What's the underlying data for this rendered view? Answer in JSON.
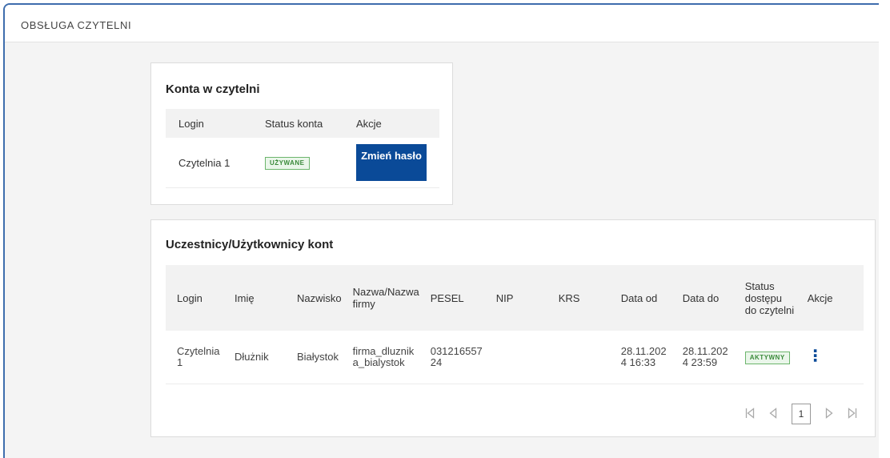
{
  "header": {
    "title": "OBSŁUGA CZYTELNI"
  },
  "accounts": {
    "title": "Konta w czytelni",
    "columns": [
      "Login",
      "Status konta",
      "Akcje"
    ],
    "rows": [
      {
        "login": "Czytelnia 1",
        "status": "UŻYWANE",
        "action": "Zmień hasło"
      }
    ]
  },
  "users": {
    "title": "Uczestnicy/Użytkownicy kont",
    "columns": [
      "Login",
      "Imię",
      "Nazwisko",
      "Nazwa/Nazwa firmy",
      "PESEL",
      "NIP",
      "KRS",
      "Data od",
      "Data do",
      "Status dostępu do czytelni",
      "Akcje"
    ],
    "rows": [
      {
        "login": "Czytelnia 1",
        "first_name": "Dłużnik",
        "last_name": "Białystok",
        "company": "firma_dluznika_bialystok",
        "pesel": "03121655724",
        "nip": "",
        "krs": "",
        "date_from": "28.11.2024 16:33",
        "date_to": "28.11.2024 23:59",
        "status": "AKTYWNY"
      }
    ],
    "pagination": {
      "current_page": "1"
    }
  },
  "colors": {
    "primary": "#0a4a98",
    "badge_green": "#3a8a3a",
    "frame_border": "#3e6dad"
  },
  "icons": {
    "first": "first-page-icon",
    "prev": "prev-page-icon",
    "next": "next-page-icon",
    "last": "last-page-icon",
    "more": "more-vertical-icon"
  }
}
